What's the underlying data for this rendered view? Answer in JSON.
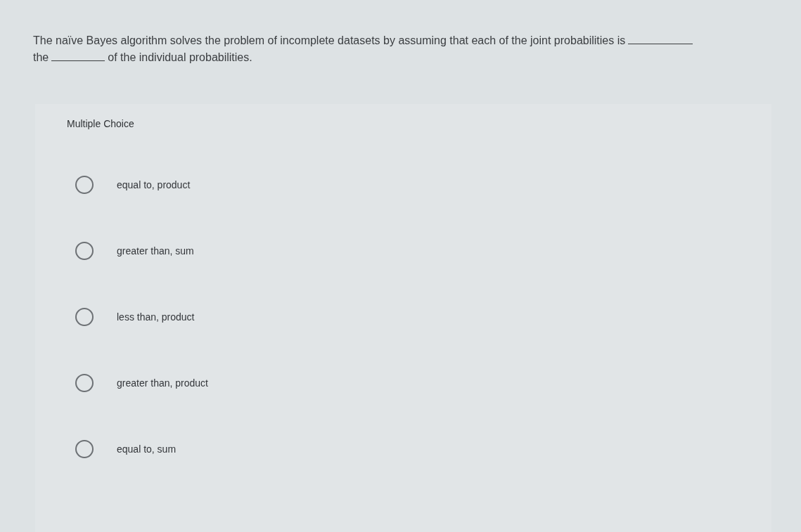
{
  "question": {
    "lines": [
      [
        {
          "kind": "text",
          "text": "The naïve Bayes algorithm solves the problem of incomplete datasets by assuming that each of the joint probabilities is"
        },
        {
          "kind": "blank"
        }
      ],
      [
        {
          "kind": "text",
          "text": "the"
        },
        {
          "kind": "blank"
        },
        {
          "kind": "text",
          "text": "of the individual probabilities."
        }
      ]
    ]
  },
  "answer_panel": {
    "heading": "Multiple Choice",
    "options": [
      {
        "label": "equal to, product",
        "selected": false
      },
      {
        "label": "greater than, sum",
        "selected": false
      },
      {
        "label": "less than, product",
        "selected": false
      },
      {
        "label": "greater than, product",
        "selected": false
      },
      {
        "label": "equal to, sum",
        "selected": false
      }
    ]
  }
}
